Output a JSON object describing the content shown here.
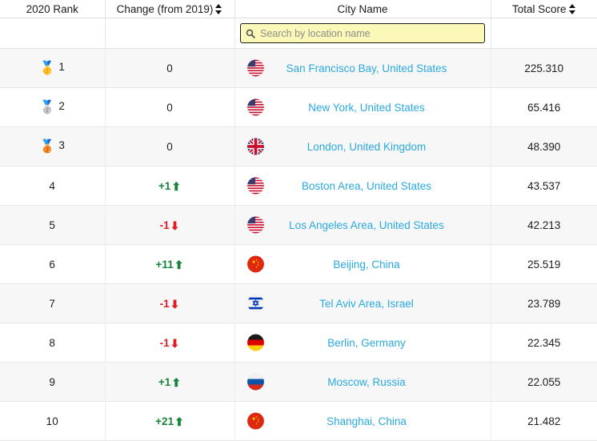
{
  "table": {
    "columns": [
      {
        "key": "rank",
        "label": "2020 Rank",
        "sortable": false
      },
      {
        "key": "change",
        "label": "Change (from 2019)",
        "sortable": true
      },
      {
        "key": "city",
        "label": "City Name",
        "sortable": false
      },
      {
        "key": "score",
        "label": "Total Score",
        "sortable": true
      }
    ],
    "search": {
      "placeholder": "Search by location name",
      "value": "",
      "icon": "search-icon",
      "background_color": "#fcf8b8",
      "border_color": "#1b1b1b"
    },
    "colors": {
      "link": "#2aa9e0",
      "change_up": "#17843a",
      "change_down": "#e01b22",
      "row_odd": "#f7f7f7",
      "row_even": "#ffffff"
    },
    "rows": [
      {
        "rank": "1",
        "medal": "🥇",
        "medal_name": "gold-medal-icon",
        "change": "0",
        "change_dir": "none",
        "arrow": "",
        "city": "San Francisco Bay, United States",
        "flag": "us",
        "flag_name": "flag-united-states-icon",
        "score": "225.310"
      },
      {
        "rank": "2",
        "medal": "🥈",
        "medal_name": "silver-medal-icon",
        "change": "0",
        "change_dir": "none",
        "arrow": "",
        "city": "New York, United States",
        "flag": "us",
        "flag_name": "flag-united-states-icon",
        "score": "65.416"
      },
      {
        "rank": "3",
        "medal": "🥉",
        "medal_name": "bronze-medal-icon",
        "change": "0",
        "change_dir": "none",
        "arrow": "",
        "city": "London, United Kingdom",
        "flag": "gb",
        "flag_name": "flag-united-kingdom-icon",
        "score": "48.390"
      },
      {
        "rank": "4",
        "medal": "",
        "medal_name": "",
        "change": "+1",
        "change_dir": "up",
        "arrow": "⬆",
        "city": "Boston Area, United States",
        "flag": "us",
        "flag_name": "flag-united-states-icon",
        "score": "43.537"
      },
      {
        "rank": "5",
        "medal": "",
        "medal_name": "",
        "change": "-1",
        "change_dir": "down",
        "arrow": "⬇",
        "city": "Los Angeles Area, United States",
        "flag": "us",
        "flag_name": "flag-united-states-icon",
        "score": "42.213"
      },
      {
        "rank": "6",
        "medal": "",
        "medal_name": "",
        "change": "+11",
        "change_dir": "up",
        "arrow": "⬆",
        "city": "Beijing, China",
        "flag": "cn",
        "flag_name": "flag-china-icon",
        "score": "25.519"
      },
      {
        "rank": "7",
        "medal": "",
        "medal_name": "",
        "change": "-1",
        "change_dir": "down",
        "arrow": "⬇",
        "city": "Tel Aviv Area, Israel",
        "flag": "il",
        "flag_name": "flag-israel-icon",
        "score": "23.789"
      },
      {
        "rank": "8",
        "medal": "",
        "medal_name": "",
        "change": "-1",
        "change_dir": "down",
        "arrow": "⬇",
        "city": "Berlin, Germany",
        "flag": "de",
        "flag_name": "flag-germany-icon",
        "score": "22.345"
      },
      {
        "rank": "9",
        "medal": "",
        "medal_name": "",
        "change": "+1",
        "change_dir": "up",
        "arrow": "⬆",
        "city": "Moscow, Russia",
        "flag": "ru",
        "flag_name": "flag-russia-icon",
        "score": "22.055"
      },
      {
        "rank": "10",
        "medal": "",
        "medal_name": "",
        "change": "+21",
        "change_dir": "up",
        "arrow": "⬆",
        "city": "Shanghai, China",
        "flag": "cn",
        "flag_name": "flag-china-icon",
        "score": "21.482"
      }
    ]
  }
}
